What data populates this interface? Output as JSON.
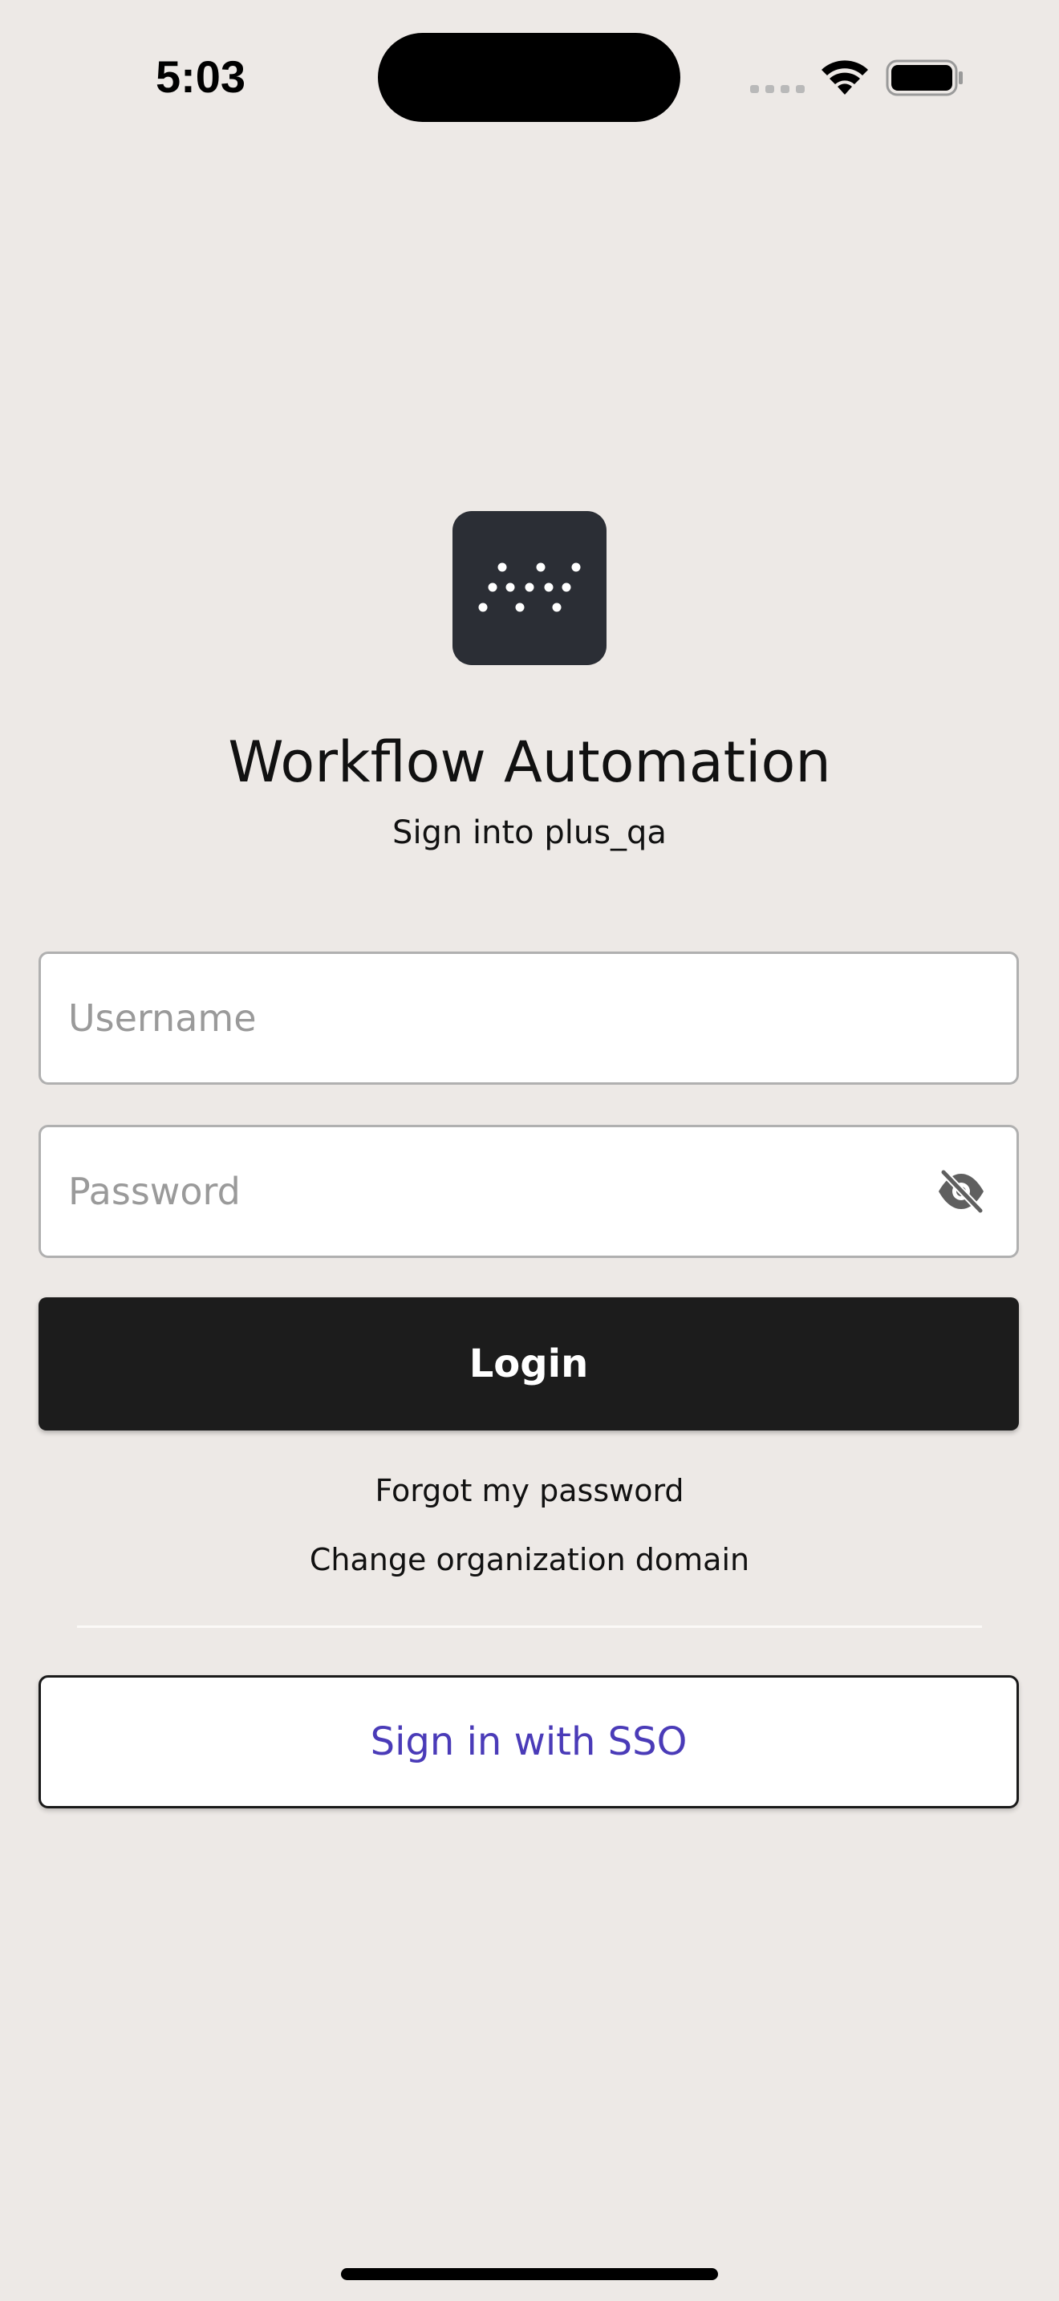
{
  "status_bar": {
    "time": "5:03"
  },
  "app": {
    "title": "Workflow Automation",
    "subtitle": "Sign into plus_qa",
    "logo_icon": "dots-logo-icon"
  },
  "form": {
    "username_placeholder": "Username",
    "username_value": "",
    "password_placeholder": "Password",
    "password_value": "",
    "password_visibility_icon": "eye-slash-icon",
    "login_label": "Login"
  },
  "links": {
    "forgot_password": "Forgot my password",
    "change_domain": "Change organization domain"
  },
  "sso": {
    "label": "Sign in with SSO"
  },
  "colors": {
    "background": "#ede9e6",
    "login_button": "#1c1c1c",
    "sso_text": "#4a3bb8",
    "logo_background": "#2b2e35"
  }
}
